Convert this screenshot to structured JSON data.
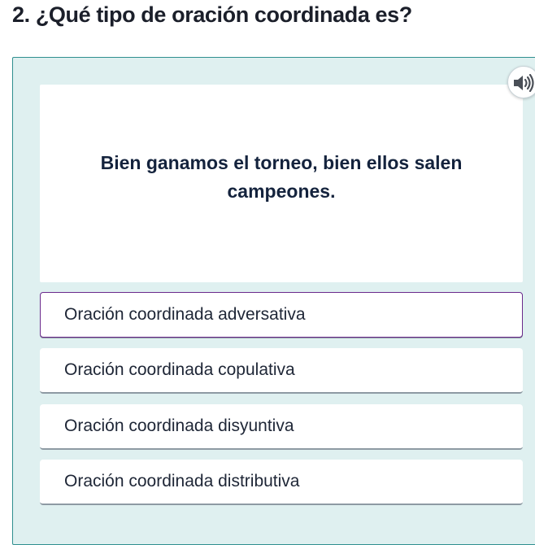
{
  "question": {
    "title": "2. ¿Qué tipo de oración coordinada es?"
  },
  "sentence": {
    "text": "Bien ganamos el torneo, bien ellos salen campeones."
  },
  "audio": {
    "icon": "speaker-icon"
  },
  "options": [
    {
      "label": "Oración coordinada adversativa",
      "selected": true
    },
    {
      "label": "Oración coordinada copulativa",
      "selected": false
    },
    {
      "label": "Oración coordinada disyuntiva",
      "selected": false
    },
    {
      "label": "Oración coordinada distributiva",
      "selected": false
    }
  ],
  "colors": {
    "panel_bg": "#dff0f0",
    "panel_border": "#2f8f8f",
    "selected_border": "#6a2a8c",
    "text_dark": "#14233d"
  }
}
